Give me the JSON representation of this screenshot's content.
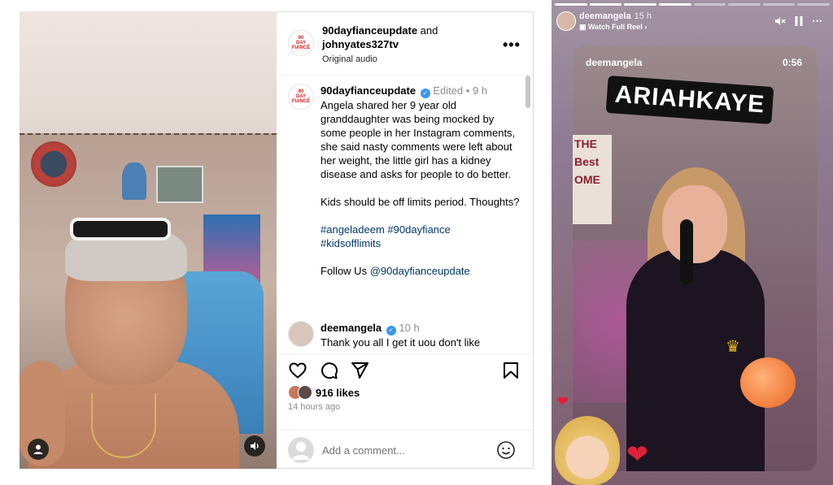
{
  "post": {
    "header": {
      "author1": "90dayfianceupdate",
      "and": "and",
      "author2": "johnyates327tv",
      "audio": "Original audio",
      "more": "•••",
      "logo_text": "90 DAY FIANCÉ UPDATE"
    },
    "caption": {
      "username": "90dayfianceupdate",
      "verified_mark": "✓",
      "edited": "Edited",
      "dot": "•",
      "time": "9 h",
      "body": "Angela shared her 9 year old granddaughter was being mocked by some people in her Instagram comments, she said nasty comments were left about her weight, the little girl has a kidney disease and asks for people to do better.",
      "body2": "Kids should be off limits period. Thoughts?",
      "hashtag1": "#angeladeem",
      "hashtag2": "#90dayfiance",
      "hashtag3": "#kidsofflimits",
      "follow_prefix": "Follow Us",
      "follow_mention": "@90dayfianceupdate"
    },
    "comment": {
      "username": "deemangela",
      "verified_mark": "✓",
      "time": "10 h",
      "text": "Thank you all I get it uou don't like"
    },
    "likes": "916 likes",
    "time_ago": "14 hours ago",
    "add_comment_placeholder": "Add a comment..."
  },
  "story": {
    "username": "deemangela",
    "time": "15 h",
    "watch_reel": "Watch Full Reel",
    "reel_user": "deemangela",
    "reel_duration": "0:56",
    "sticker_text": "ARIAHKAYE",
    "wall_sign": "THE Best OME"
  },
  "colors": {
    "verified_blue": "#3897f0",
    "link_blue": "#00376b",
    "muted_gray": "#8e8e8e",
    "heart_red": "#e0203a"
  },
  "icons": {
    "like": "heart-icon",
    "comment": "comment-icon",
    "share": "send-icon",
    "save": "bookmark-icon",
    "mute": "mute-icon",
    "pause": "pause-icon",
    "more_story": "more-icon",
    "emoji": "emoji-icon",
    "user": "user-icon",
    "sound": "sound-icon"
  }
}
